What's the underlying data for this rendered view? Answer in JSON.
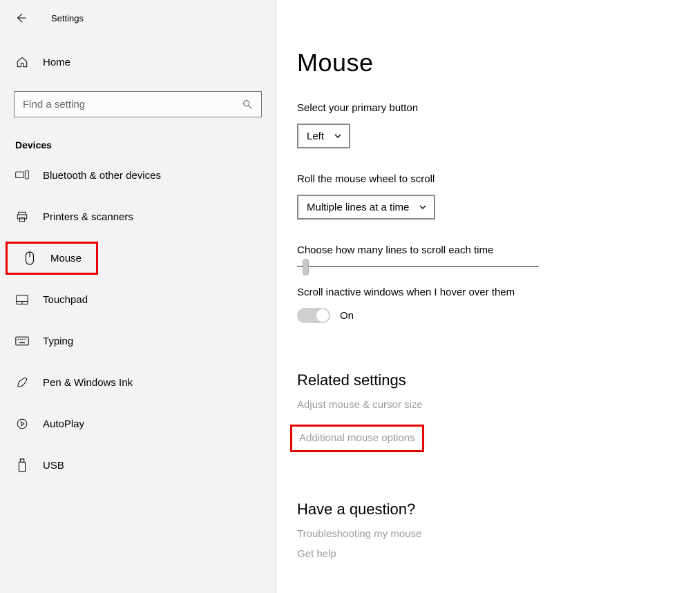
{
  "window": {
    "title": "Settings"
  },
  "sidebar": {
    "home": "Home",
    "search_placeholder": "Find a setting",
    "section": "Devices",
    "items": [
      {
        "id": "bluetooth",
        "label": "Bluetooth & other devices"
      },
      {
        "id": "printers",
        "label": "Printers & scanners"
      },
      {
        "id": "mouse",
        "label": "Mouse",
        "highlighted": true
      },
      {
        "id": "touchpad",
        "label": "Touchpad"
      },
      {
        "id": "typing",
        "label": "Typing"
      },
      {
        "id": "pen",
        "label": "Pen & Windows Ink"
      },
      {
        "id": "autoplay",
        "label": "AutoPlay"
      },
      {
        "id": "usb",
        "label": "USB"
      }
    ]
  },
  "main": {
    "title": "Mouse",
    "primary_button": {
      "label": "Select your primary button",
      "value": "Left"
    },
    "wheel": {
      "label": "Roll the mouse wheel to scroll",
      "value": "Multiple lines at a time"
    },
    "lines": {
      "label": "Choose how many lines to scroll each time"
    },
    "inactive": {
      "label": "Scroll inactive windows when I hover over them",
      "state": "On"
    },
    "related": {
      "heading": "Related settings",
      "links": [
        "Adjust mouse & cursor size",
        "Additional mouse options"
      ],
      "highlighted_index": 1
    },
    "question": {
      "heading": "Have a question?",
      "links": [
        "Troubleshooting my mouse",
        "Get help"
      ]
    }
  }
}
